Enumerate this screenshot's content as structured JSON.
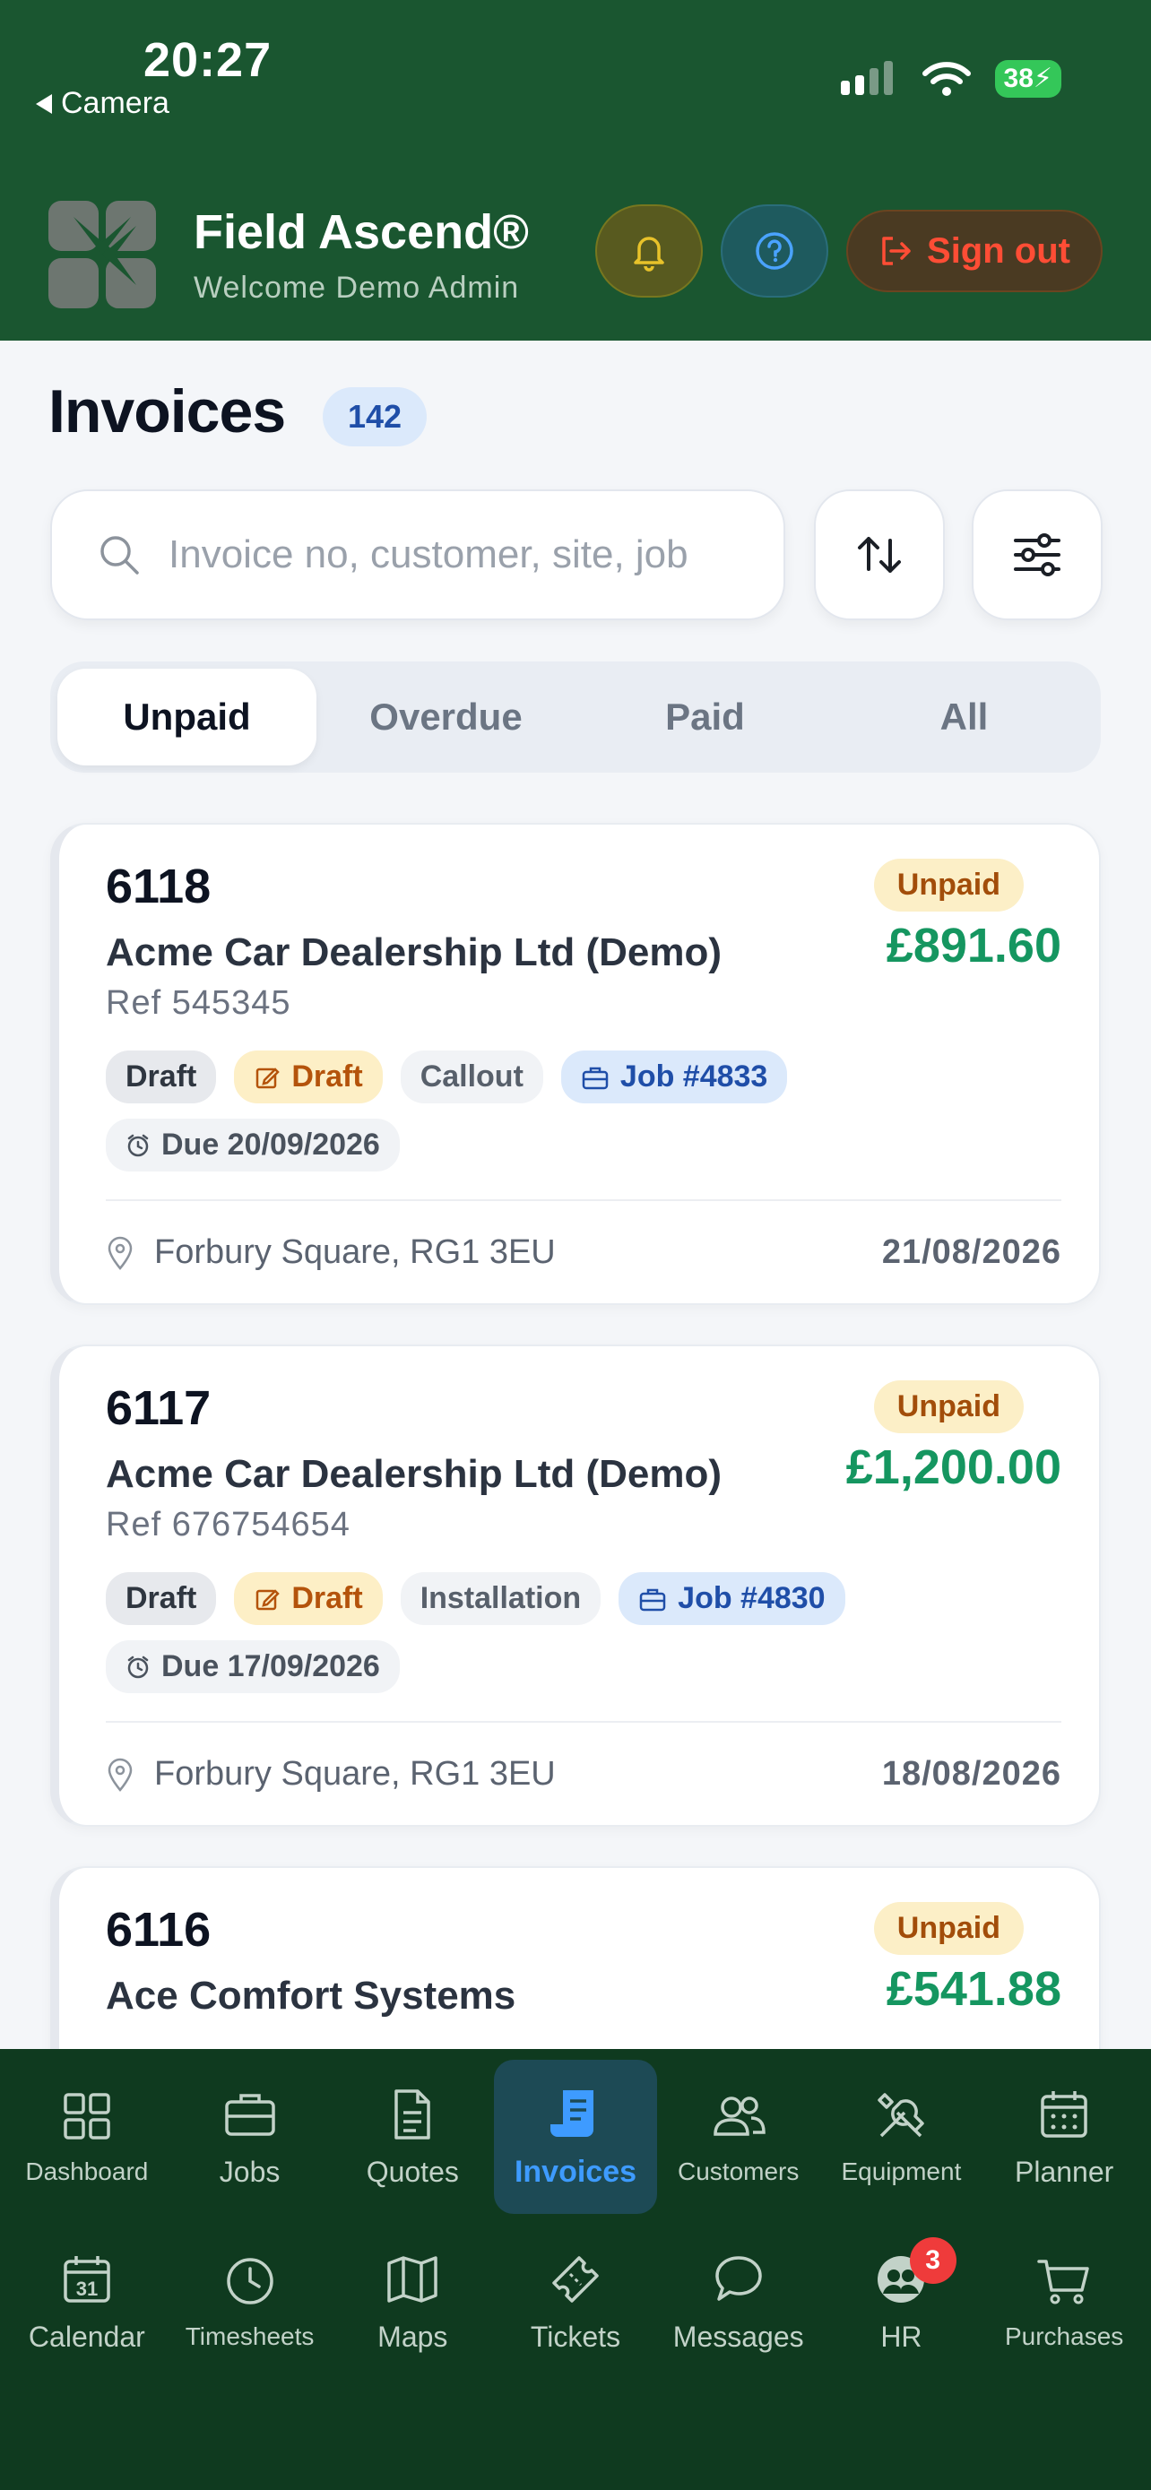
{
  "status_bar": {
    "time": "20:27",
    "back_label": "Camera",
    "battery": "38"
  },
  "header": {
    "app_name": "Field Ascend®",
    "welcome": "Welcome Demo Admin",
    "sign_out_label": "Sign out",
    "colors": {
      "background": "#1a5630",
      "sign_out": "#ff4d35"
    }
  },
  "page": {
    "title": "Invoices",
    "count": "142"
  },
  "search": {
    "placeholder": "Invoice no, customer, site, job",
    "value": ""
  },
  "tabs": [
    {
      "label": "Unpaid",
      "active": true
    },
    {
      "label": "Overdue",
      "active": false
    },
    {
      "label": "Paid",
      "active": false
    },
    {
      "label": "All",
      "active": false
    }
  ],
  "invoices": [
    {
      "number": "6118",
      "customer": "Acme Car Dealership Ltd (Demo)",
      "ref": "Ref 545345",
      "status": "Unpaid",
      "amount": "£891.60",
      "chips": {
        "state": "Draft",
        "draft": "Draft",
        "type": "Callout",
        "job": "Job #4833"
      },
      "due": "Due 20/09/2026",
      "location": "Forbury Square, RG1 3EU",
      "date": "21/08/2026"
    },
    {
      "number": "6117",
      "customer": "Acme Car Dealership Ltd (Demo)",
      "ref": "Ref 676754654",
      "status": "Unpaid",
      "amount": "£1,200.00",
      "chips": {
        "state": "Draft",
        "draft": "Draft",
        "type": "Installation",
        "job": "Job #4830"
      },
      "due": "Due 17/09/2026",
      "location": "Forbury Square, RG1 3EU",
      "date": "18/08/2026"
    },
    {
      "number": "6116",
      "customer": "Ace Comfort Systems",
      "status": "Unpaid",
      "amount": "£541.88"
    }
  ],
  "nav": {
    "row1": [
      {
        "label": "Dashboard",
        "icon": "grid-icon"
      },
      {
        "label": "Jobs",
        "icon": "briefcase-icon"
      },
      {
        "label": "Quotes",
        "icon": "document-icon"
      },
      {
        "label": "Invoices",
        "icon": "receipt-icon",
        "active": true
      },
      {
        "label": "Customers",
        "icon": "users-icon"
      },
      {
        "label": "Equipment",
        "icon": "tools-icon"
      },
      {
        "label": "Planner",
        "icon": "calendar-grid-icon"
      }
    ],
    "row2": [
      {
        "label": "Calendar",
        "icon": "calendar-icon",
        "day": "31"
      },
      {
        "label": "Timesheets",
        "icon": "clock-icon"
      },
      {
        "label": "Maps",
        "icon": "map-icon"
      },
      {
        "label": "Tickets",
        "icon": "ticket-icon"
      },
      {
        "label": "Messages",
        "icon": "chat-icon"
      },
      {
        "label": "HR",
        "icon": "people-icon",
        "badge": "3"
      },
      {
        "label": "Purchases",
        "icon": "cart-icon"
      }
    ]
  }
}
